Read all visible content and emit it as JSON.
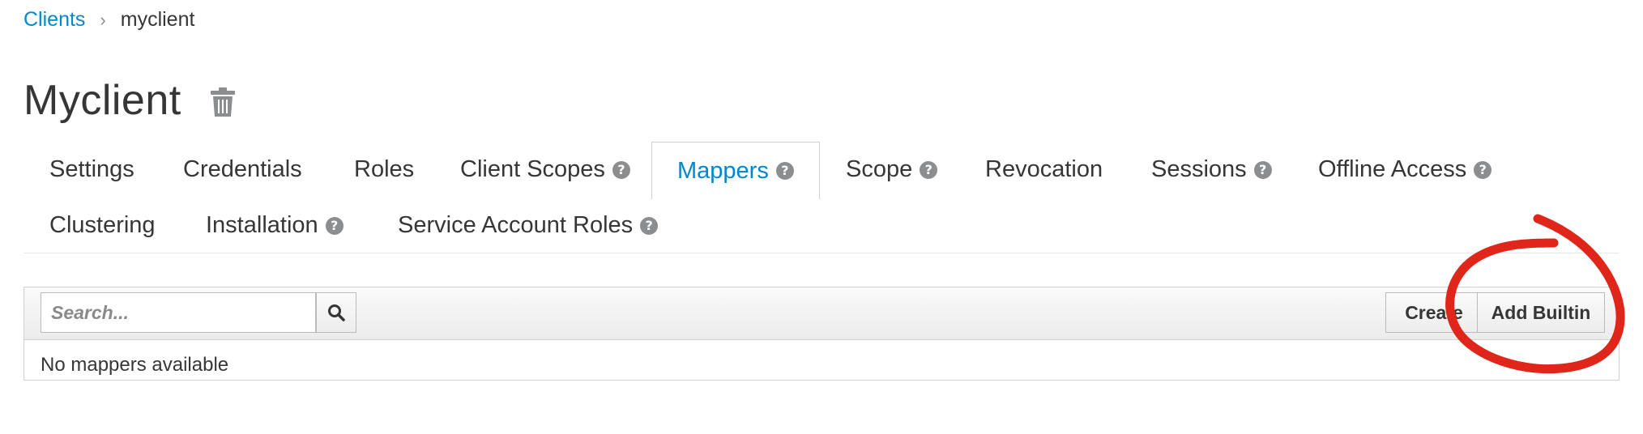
{
  "breadcrumb": {
    "parent": "Clients",
    "separator": "›",
    "current": "myclient"
  },
  "page": {
    "title": "Myclient"
  },
  "tabs": [
    {
      "label": "Settings",
      "help": false
    },
    {
      "label": "Credentials",
      "help": false
    },
    {
      "label": "Roles",
      "help": false
    },
    {
      "label": "Client Scopes",
      "help": true
    },
    {
      "label": "Mappers",
      "help": true,
      "active": true
    },
    {
      "label": "Scope",
      "help": true
    },
    {
      "label": "Revocation",
      "help": false
    },
    {
      "label": "Sessions",
      "help": true
    },
    {
      "label": "Offline Access",
      "help": true
    },
    {
      "label": "Clustering",
      "help": false
    },
    {
      "label": "Installation",
      "help": true
    },
    {
      "label": "Service Account Roles",
      "help": true
    }
  ],
  "help_glyph": "?",
  "toolbar": {
    "search_placeholder": "Search...",
    "create_label": "Create",
    "add_builtin_label": "Add Builtin"
  },
  "table": {
    "empty_message": "No mappers available"
  },
  "icons": {
    "delete": "trash-icon",
    "search": "search-icon",
    "help": "question-circle-icon"
  },
  "colors": {
    "link": "#0088ce",
    "annotation": "#e0261b"
  }
}
